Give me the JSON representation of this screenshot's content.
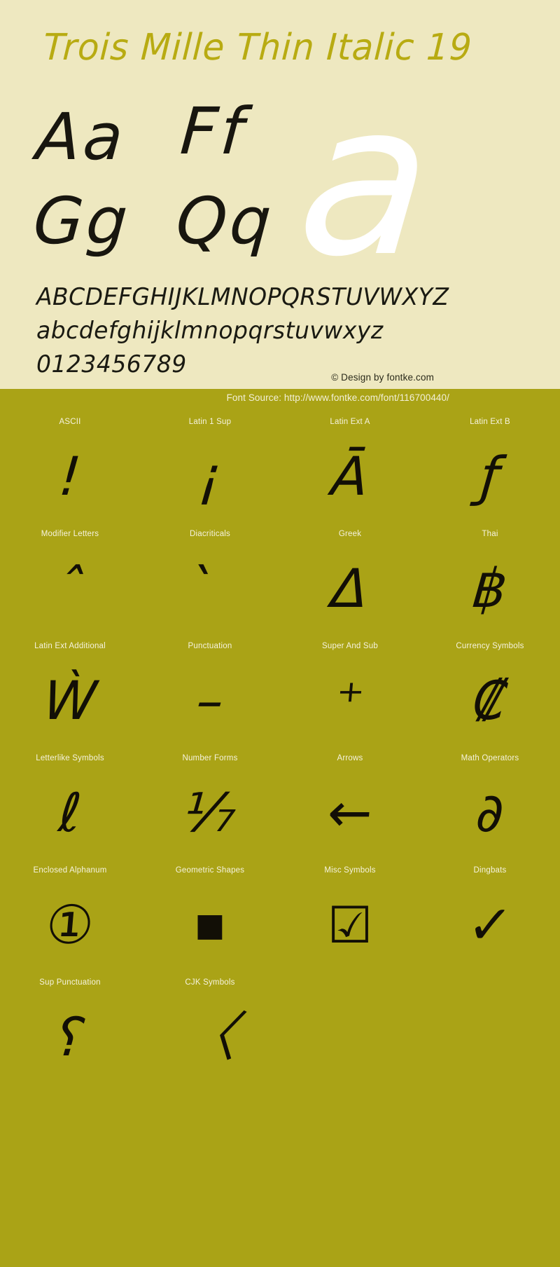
{
  "page": {
    "background_color": "#aaa316",
    "specimen_background_color": "#eee8c0",
    "title_color": "#b8ab12",
    "glyph_color": "#18160f",
    "big_glyph_color": "#ffffff",
    "label_color": "#f6f3de"
  },
  "specimen": {
    "title": "Trois Mille Thin Italic 19",
    "glyph_pairs": [
      "Aa",
      "Ff",
      "Gg",
      "Qq"
    ],
    "big_glyph": "a",
    "uppercase": "ABCDEFGHIJKLMNOPQRSTUVWXYZ",
    "lowercase": "abcdefghijklmnopqrstuvwxyz",
    "digits": "0123456789",
    "credit": "© Design by fontke.com"
  },
  "blocks": {
    "font_source": "Font Source: http://www.fontke.com/font/116700440/",
    "cells": [
      {
        "label": "ASCII",
        "glyph": "!"
      },
      {
        "label": "Latin 1 Sup",
        "glyph": "¡"
      },
      {
        "label": "Latin Ext A",
        "glyph": "Ā"
      },
      {
        "label": "Latin Ext B",
        "glyph": "ƒ"
      },
      {
        "label": "Modifier Letters",
        "glyph": "ˆ"
      },
      {
        "label": "Diacriticals",
        "glyph": "̀"
      },
      {
        "label": "Greek",
        "glyph": "Δ"
      },
      {
        "label": "Thai",
        "glyph": "฿"
      },
      {
        "label": "Latin Ext Additional",
        "glyph": "Ẁ"
      },
      {
        "label": "Punctuation",
        "glyph": "–"
      },
      {
        "label": "Super And Sub",
        "glyph": "⁺"
      },
      {
        "label": "Currency Symbols",
        "glyph": "₡"
      },
      {
        "label": "Letterlike Symbols",
        "glyph": "ℓ"
      },
      {
        "label": "Number Forms",
        "glyph": "⅐"
      },
      {
        "label": "Arrows",
        "glyph": "←"
      },
      {
        "label": "Math Operators",
        "glyph": "∂"
      },
      {
        "label": "Enclosed Alphanum",
        "glyph": "①"
      },
      {
        "label": "Geometric Shapes",
        "glyph": "■"
      },
      {
        "label": "Misc Symbols",
        "glyph": "☑"
      },
      {
        "label": "Dingbats",
        "glyph": "✓"
      },
      {
        "label": "Sup Punctuation",
        "glyph": "⸮"
      },
      {
        "label": "CJK Symbols",
        "glyph": "〈"
      },
      {
        "label": "",
        "glyph": ""
      },
      {
        "label": "",
        "glyph": ""
      }
    ]
  }
}
